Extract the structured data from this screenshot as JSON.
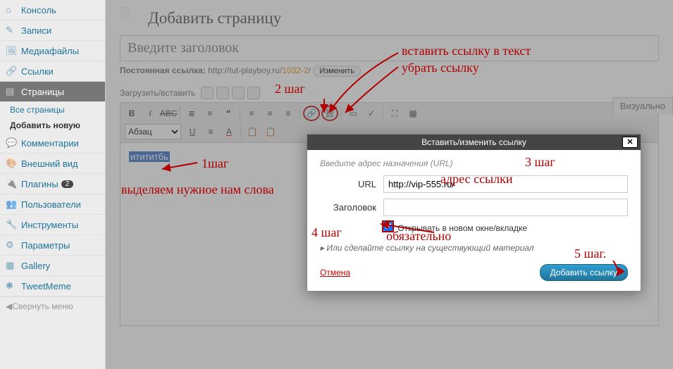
{
  "sidebar": {
    "items": [
      {
        "label": "Консоль",
        "icon": "dashboard"
      },
      {
        "label": "Записи",
        "icon": "pin"
      },
      {
        "label": "Медиафайлы",
        "icon": "media"
      },
      {
        "label": "Ссылки",
        "icon": "link"
      },
      {
        "label": "Страницы",
        "icon": "page",
        "current": true
      },
      {
        "label": "Комментарии",
        "icon": "comment"
      },
      {
        "label": "Внешний вид",
        "icon": "appearance"
      },
      {
        "label": "Плагины",
        "icon": "plugin",
        "badge": "2"
      },
      {
        "label": "Пользователи",
        "icon": "users"
      },
      {
        "label": "Инструменты",
        "icon": "tools"
      },
      {
        "label": "Параметры",
        "icon": "settings"
      },
      {
        "label": "Gallery",
        "icon": "gallery"
      },
      {
        "label": "TweetMeme",
        "icon": "tweet"
      }
    ],
    "subs": [
      {
        "label": "Все страницы"
      },
      {
        "label": "Добавить новую",
        "active": true
      }
    ],
    "collapse": "Свернуть меню"
  },
  "header": {
    "title": "Добавить страницу"
  },
  "title_placeholder": "Введите заголовок",
  "permalink": {
    "label": "Постоянная ссылка:",
    "base": "http://tut-playboy.ru/",
    "slug": "1032-2",
    "trail": "/",
    "edit": "Изменить"
  },
  "upload": {
    "label": "Загрузить/вставить"
  },
  "editor_tab": "Визуально",
  "format_select": "Абзац",
  "selected_text": "итититбь",
  "dialog": {
    "title": "Вставить/изменить ссылку",
    "hint": "Введите адрес назначения (URL)",
    "url_label": "URL",
    "url_value": "http://vip-555.ru/",
    "title_label": "Заголовок",
    "title_value": "",
    "newtab": "Открывать в новом окне/вкладке",
    "expand": "Или сделайте ссылку на существующий материал",
    "cancel": "Отмена",
    "submit": "Добавить ссылку"
  },
  "annotations": {
    "step1": "1шаг",
    "step1_desc": "выделяем нужное нам слова",
    "step2": "2 шаг",
    "insert": "вставить ссылку в текст",
    "remove": "убрать ссылку",
    "step3": "3 шаг",
    "addr": "адрес ссылки",
    "step4": "4 шаг",
    "mandatory": "обязательно",
    "step5": "5 шаг."
  }
}
